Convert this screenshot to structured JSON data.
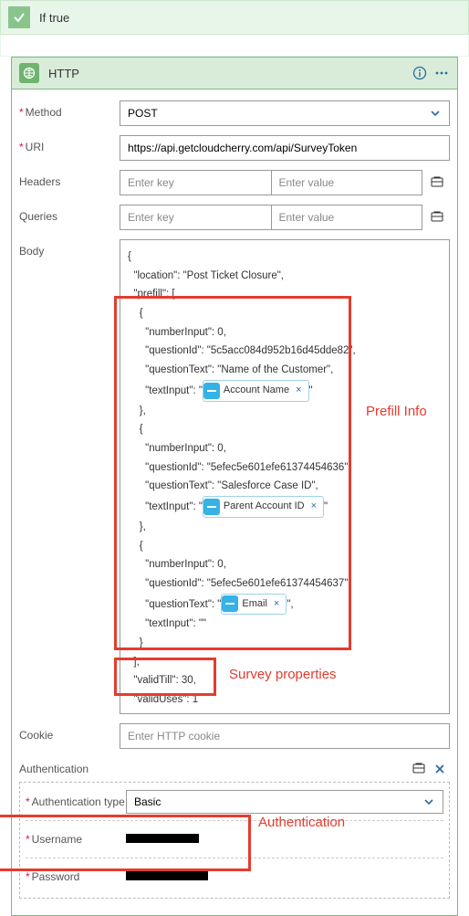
{
  "condition": {
    "label": "If true"
  },
  "http": {
    "title": "HTTP",
    "method_label": "Method",
    "method_value": "POST",
    "uri_label": "URI",
    "uri_value": "https://api.getcloudcherry.com/api/SurveyToken",
    "headers_label": "Headers",
    "queries_label": "Queries",
    "kv_key_placeholder": "Enter key",
    "kv_value_placeholder": "Enter value",
    "body_label": "Body",
    "cookie_label": "Cookie",
    "cookie_placeholder": "Enter HTTP cookie"
  },
  "body_code": {
    "l1": "{",
    "l2": "  \"location\": \"Post Ticket Closure\",",
    "l3": "  \"prefill\": [",
    "l4": "    {",
    "l5": "      \"numberInput\": 0,",
    "l6": "      \"questionId\": \"5c5acc084d952b16d45dde82\",",
    "l7": "      \"questionText\": \"Name of the Customer\",",
    "l8a": "      \"textInput\": \"",
    "l8b": "\"",
    "l9": "    },",
    "l10": "    {",
    "l11": "      \"numberInput\": 0,",
    "l12": "      \"questionId\": \"5efec5e601efe61374454636\",",
    "l13": "      \"questionText\": \"Salesforce Case ID\",",
    "l14a": "      \"textInput\": \"",
    "l14b": "\"",
    "l15": "    },",
    "l16": "    {",
    "l17": "      \"numberInput\": 0,",
    "l18": "      \"questionId\": \"5efec5e601efe61374454637\",",
    "l19a": "      \"questionText\": \"",
    "l19b": "\",",
    "l20": "      \"textInput\": \"\"",
    "l21": "    }",
    "l22": "  ],",
    "l23": "  \"validTill\": 30,",
    "l24": "  \"validUses\": 1",
    "l25": "}"
  },
  "tokens": {
    "account_name": "Account Name",
    "parent_account_id": "Parent Account ID",
    "email": "Email",
    "close_glyph": "×"
  },
  "annotations": {
    "prefill": "Prefill Info",
    "survey": "Survey properties",
    "auth": "Authentication"
  },
  "auth": {
    "section_label": "Authentication",
    "type_label": "Authentication type",
    "type_value": "Basic",
    "username_label": "Username",
    "password_label": "Password"
  }
}
